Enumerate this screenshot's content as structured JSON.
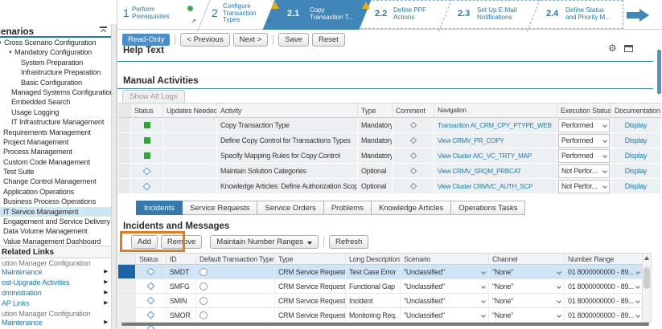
{
  "sidebar": {
    "title": "Scenarios",
    "tree": [
      {
        "label": "Cross Scenario Configuration"
      },
      {
        "label": "Mandatory Configuration"
      },
      {
        "label": "System Preparation"
      },
      {
        "label": "Infrastructure Preparation"
      },
      {
        "label": "Basic Configuration"
      },
      {
        "label": "Managed Systems Configuration"
      },
      {
        "label": "Embedded Search"
      },
      {
        "label": "Usage Logging"
      },
      {
        "label": "IT Infrastructure Management"
      },
      {
        "label": "Requirements Management"
      },
      {
        "label": "Project Management"
      },
      {
        "label": "Process Management"
      },
      {
        "label": "Custom Code Management"
      },
      {
        "label": "Test Suite"
      },
      {
        "label": "Change Control Management"
      },
      {
        "label": "Application Operations"
      },
      {
        "label": "Business Process Operations"
      },
      {
        "label": "IT Service Management"
      },
      {
        "label": "Engagement and Service Delivery"
      },
      {
        "label": "Data Volume Management"
      },
      {
        "label": "Value Management Dashboard"
      }
    ],
    "related_title": "Related Links",
    "related": [
      {
        "l1": "ution Manager Configuration",
        "l2": "Maintenance"
      },
      {
        "l1": "ost-Upgrade Activities",
        "l2": ""
      },
      {
        "l1": "dministration",
        "l2": ""
      },
      {
        "l1": "AP Links",
        "l2": ""
      },
      {
        "l1": "ution Manager Configuration",
        "l2": "Maintenance"
      }
    ]
  },
  "wizard": {
    "s1": {
      "num": "1",
      "l1": "Perform",
      "l2": "Prerequisites"
    },
    "s2": {
      "num": "2",
      "l1": "Configure",
      "l2": "Transaction",
      "l3": "Types"
    },
    "s21": {
      "num": "2.1",
      "l1": "Copy",
      "l2": "Transaction T..."
    },
    "s22": {
      "num": "2.2",
      "l1": "Define PPF",
      "l2": "Actions"
    },
    "s23": {
      "num": "2.3",
      "l1": "Set Up E-Mail",
      "l2": "Notifications"
    },
    "s24": {
      "num": "2.4",
      "l1": "Define Status",
      "l2": "and Priority M..."
    }
  },
  "toolbar": {
    "read_only": "Read-Only",
    "previous": "< Previous",
    "next": "Next >",
    "save": "Save",
    "reset": "Reset"
  },
  "help": {
    "title": "Help Text"
  },
  "ma": {
    "title": "Manual Activities",
    "show_all_logs": "Show All Logs",
    "headers": {
      "status": "Status",
      "updates": "Updates Needed",
      "activity": "Activity",
      "type": "Type",
      "comment": "Comment",
      "navigation": "Navigation",
      "exec": "Execution Status",
      "doc": "Documentation"
    },
    "rows": [
      {
        "status": "performed",
        "activity": "Copy Transaction Type",
        "type": "Mandatory",
        "navigation": "Transaction AI_CRM_CPY_PTYPE_WEB",
        "exec": "Performed",
        "doc": "Display"
      },
      {
        "status": "performed",
        "activity": "Define Copy Control for Transactions Types",
        "type": "Mandatory",
        "navigation": "View CRMV_PR_COPY",
        "exec": "Performed",
        "doc": "Display"
      },
      {
        "status": "performed",
        "activity": "Specify Mapping Rules for Copy Control",
        "type": "Mandatory",
        "navigation": "View Cluster AIC_VC_TRTY_MAP",
        "exec": "Performed",
        "doc": "Display"
      },
      {
        "status": "open",
        "activity": "Maintain Solution Categories",
        "type": "Optional",
        "navigation": "View CRMV_SRQM_PRBCAT",
        "exec": "Not Perfor...",
        "doc": "Display"
      },
      {
        "status": "open",
        "activity": "Knowledge Articles: Define Authorization Scopes",
        "type": "Optional",
        "navigation": "View Cluster CRMVC_AUTH_SCP",
        "exec": "Not Perfor...",
        "doc": "Display"
      }
    ]
  },
  "tabs": [
    {
      "label": "Incidents"
    },
    {
      "label": "Service Requests"
    },
    {
      "label": "Service Orders"
    },
    {
      "label": "Problems"
    },
    {
      "label": "Knowledge Articles"
    },
    {
      "label": "Operations Tasks"
    }
  ],
  "inc": {
    "title": "Incidents and Messages",
    "add": "Add",
    "remove": "Remove",
    "maintain": "Maintain Number Ranges",
    "refresh": "Refresh",
    "headers": {
      "status": "Status",
      "id": "ID",
      "dtt": "Default Transaction Type",
      "type": "Type",
      "desc": "Long Description",
      "scenario": "Scenario",
      "channel": "Channel",
      "range": "Number Range"
    },
    "rows": [
      {
        "id": "SMDT",
        "type": "CRM Service Request",
        "desc": "Test Case Error",
        "scenario": "\"Unclassified\"",
        "channel": "\"None\"",
        "range": "01 8000000000 - 89..."
      },
      {
        "id": "SMFG",
        "type": "CRM Service Request",
        "desc": "Functional Gap",
        "scenario": "\"Unclassified\"",
        "channel": "\"None\"",
        "range": "01 8000000000 - 89..."
      },
      {
        "id": "SMIN",
        "type": "CRM Service Request",
        "desc": "Incident",
        "scenario": "\"Unclassified\"",
        "channel": "\"None\"",
        "range": "01 8000000000 - 89..."
      },
      {
        "id": "SMOR",
        "type": "CRM Service Request",
        "desc": "Monitoring Req.",
        "scenario": "\"Unclassified\"",
        "channel": "\"None\"",
        "range": "01 8000000000 - 89..."
      }
    ]
  },
  "colors": {
    "accent_blue": "#3b86bb",
    "selected_step": "#4186b8",
    "warning": "#f0ab00",
    "annotation_orange": "#e87b16",
    "status_green": "#2fa737",
    "link_blue": "#1a7ead",
    "selected_row": "#cfe4f4"
  }
}
